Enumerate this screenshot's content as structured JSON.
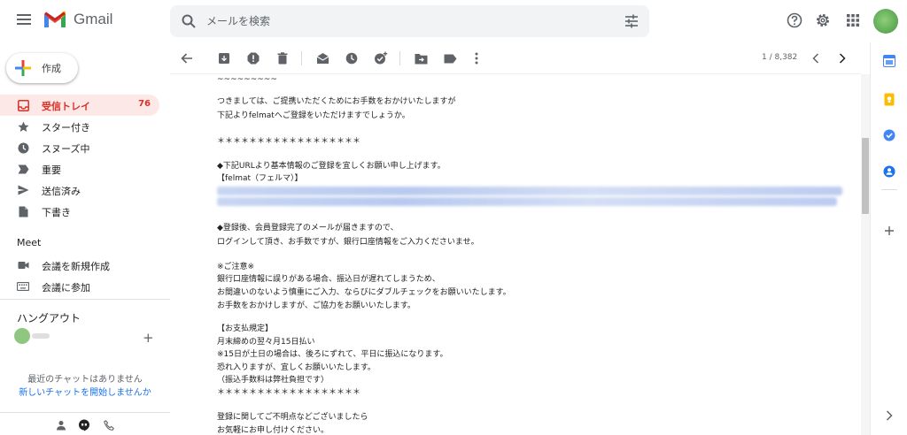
{
  "header": {
    "app_name": "Gmail",
    "search_placeholder": "メールを検索"
  },
  "sidebar": {
    "compose_label": "作成",
    "items": [
      {
        "label": "受信トレイ",
        "count": "76",
        "icon": "inbox-icon",
        "active": true
      },
      {
        "label": "スター付き",
        "icon": "star-icon"
      },
      {
        "label": "スヌーズ中",
        "icon": "clock-icon"
      },
      {
        "label": "重要",
        "icon": "label-important-icon"
      },
      {
        "label": "送信済み",
        "icon": "send-icon"
      },
      {
        "label": "下書き",
        "icon": "draft-icon"
      }
    ],
    "meet_title": "Meet",
    "meet_items": [
      {
        "label": "会議を新規作成",
        "icon": "videocam-icon"
      },
      {
        "label": "会議に参加",
        "icon": "keyboard-icon"
      }
    ],
    "hangouts_title": "ハングアウト",
    "no_chats": "最近のチャットはありません",
    "start_chat_link": "新しいチャットを開始しませんか"
  },
  "toolbar": {
    "pager_text": "1 / 8,382"
  },
  "message": {
    "lines": [
      "~~~~~~~~~",
      "つきましては、ご提携いただくためにお手数をおかけいたしますが",
      "下記よりfelmatへご登録をいただけますでしょうか。",
      "＊＊＊＊＊＊＊＊＊＊＊＊＊＊＊＊＊＊",
      "◆下記URLより基本情報のご登録を宜しくお願い申し上げます。",
      "【felmat（フェルマ）】",
      "◆登録後、会員登録完了のメールが届きますので、",
      "ログインして頂き、お手数ですが、銀行口座情報をご入力くださいませ。",
      "※ご注意※",
      "銀行口座情報に誤りがある場合、振込日が遅れてしまうため、",
      "お間違いのないよう慎重にご入力、ならびにダブルチェックをお願いいたします。",
      "お手数をおかけしますが、ご協力をお願いいたします。",
      "【お支払規定】",
      "月末締めの翌々月15日払い",
      "※15日が土日の場合は、後ろにずれて、平日に振込になります。",
      "恐れ入りますが、宜しくお願いいたします。",
      "（振込手数料は弊社負担です）",
      "＊＊＊＊＊＊＊＊＊＊＊＊＊＊＊＊＊＊",
      "登録に関してご不明点などございましたら",
      "お気軽にお申し付けください。"
    ]
  },
  "colors": {
    "accent_red": "#d93025",
    "active_bg": "#fce8e6",
    "link_blue": "#1a73e8"
  }
}
